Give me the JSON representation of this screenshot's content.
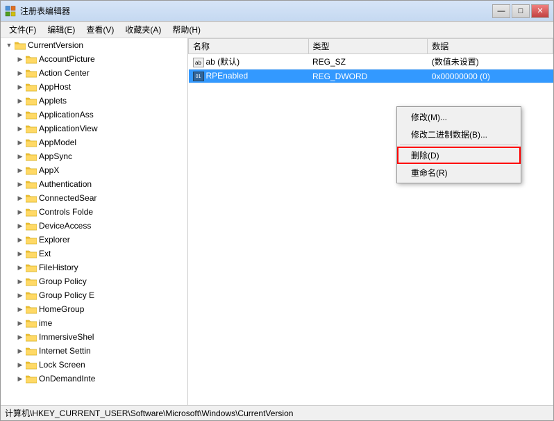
{
  "window": {
    "title": "注册表编辑器",
    "icon": "regedit-icon"
  },
  "titlebar": {
    "minimize": "—",
    "maximize": "□",
    "close": "✕"
  },
  "menubar": {
    "items": [
      "文件(F)",
      "编辑(E)",
      "查看(V)",
      "收藏夹(A)",
      "帮助(H)"
    ]
  },
  "tree": {
    "items": [
      {
        "label": "CurrentVersion",
        "indent": 0,
        "expanded": true,
        "selected": false
      },
      {
        "label": "AccountPicture",
        "indent": 1,
        "expanded": false,
        "selected": false
      },
      {
        "label": "Action Center",
        "indent": 1,
        "expanded": false,
        "selected": false
      },
      {
        "label": "AppHost",
        "indent": 1,
        "expanded": false,
        "selected": false
      },
      {
        "label": "Applets",
        "indent": 1,
        "expanded": false,
        "selected": false
      },
      {
        "label": "ApplicationAss",
        "indent": 1,
        "expanded": false,
        "selected": false
      },
      {
        "label": "ApplicationView",
        "indent": 1,
        "expanded": false,
        "selected": false
      },
      {
        "label": "AppModel",
        "indent": 1,
        "expanded": false,
        "selected": false
      },
      {
        "label": "AppSync",
        "indent": 1,
        "expanded": false,
        "selected": false
      },
      {
        "label": "AppX",
        "indent": 1,
        "expanded": false,
        "selected": false
      },
      {
        "label": "Authentication",
        "indent": 1,
        "expanded": false,
        "selected": false
      },
      {
        "label": "ConnectedSear",
        "indent": 1,
        "expanded": false,
        "selected": false
      },
      {
        "label": "Controls Folde",
        "indent": 1,
        "expanded": false,
        "selected": false
      },
      {
        "label": "DeviceAccess",
        "indent": 1,
        "expanded": false,
        "selected": false
      },
      {
        "label": "Explorer",
        "indent": 1,
        "expanded": false,
        "selected": false
      },
      {
        "label": "Ext",
        "indent": 1,
        "expanded": false,
        "selected": false
      },
      {
        "label": "FileHistory",
        "indent": 1,
        "expanded": false,
        "selected": false
      },
      {
        "label": "Group Policy",
        "indent": 1,
        "expanded": false,
        "selected": false
      },
      {
        "label": "Group Policy E",
        "indent": 1,
        "expanded": false,
        "selected": false
      },
      {
        "label": "HomeGroup",
        "indent": 1,
        "expanded": false,
        "selected": false
      },
      {
        "label": "ime",
        "indent": 1,
        "expanded": false,
        "selected": false
      },
      {
        "label": "ImmersiveShel",
        "indent": 1,
        "expanded": false,
        "selected": false
      },
      {
        "label": "Internet Settin",
        "indent": 1,
        "expanded": false,
        "selected": false
      },
      {
        "label": "Lock Screen",
        "indent": 1,
        "expanded": false,
        "selected": false
      },
      {
        "label": "OnDemandInte",
        "indent": 1,
        "expanded": false,
        "selected": false
      }
    ]
  },
  "table": {
    "columns": [
      "名称",
      "类型",
      "数据"
    ],
    "rows": [
      {
        "name": "ab (默认)",
        "type": "REG_SZ",
        "data": "(数值未设置)",
        "selected": false,
        "icon": "ab-icon"
      },
      {
        "name": "RPEnabled",
        "type": "REG_DWORD",
        "data": "0x00000000 (0)",
        "selected": true,
        "icon": "bin-icon"
      }
    ]
  },
  "context_menu": {
    "items": [
      {
        "label": "修改(M)...",
        "key": "modify"
      },
      {
        "label": "修改二进制数据(B)...",
        "key": "modify-binary"
      },
      {
        "separator": true
      },
      {
        "label": "删除(D)",
        "key": "delete",
        "highlighted": true
      },
      {
        "separator": false
      },
      {
        "label": "重命名(R)",
        "key": "rename"
      }
    ]
  },
  "statusbar": {
    "path": "计算机\\HKEY_CURRENT_USER\\Software\\Microsoft\\Windows\\CurrentVersion"
  }
}
